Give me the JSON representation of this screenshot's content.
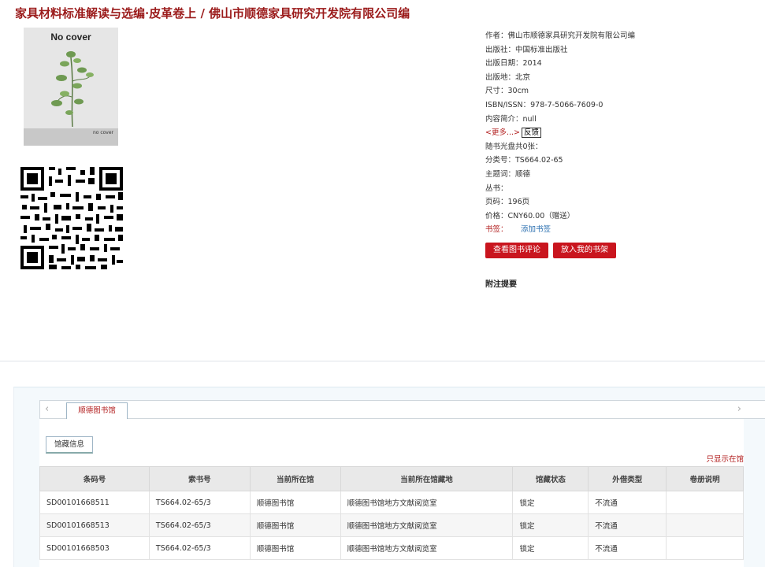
{
  "book": {
    "title": "家具材料标准解读与选编·皮革卷上 / 佛山市顺德家具研究开发院有限公司编",
    "cover_top_text": "No cover",
    "cover_bottom_text": "no cover"
  },
  "meta": {
    "author": "作者：佛山市顺德家具研究开发院有限公司编",
    "publisher": "出版社：中国标准出版社",
    "pub_date": "出版日期：2014",
    "pub_place": "出版地：北京",
    "size": "尺寸：30cm",
    "isbn": "ISBN/ISSN：978-7-5066-7609-0",
    "summary": "内容简介：null",
    "more_link": "<更多...>",
    "feedback_button": "反馈",
    "cd": "随书光盘共0张：",
    "class_no": "分类号：TS664.02-65",
    "subject": "主题词：顺德",
    "series": "丛书：",
    "pages": "页码：196页",
    "price": "价格：CNY60.00（赠送）",
    "bookmark_label": "书签：",
    "bookmark_link": "添加书签",
    "review_button": "查看图书评论",
    "shelf_button": "放入我的书架",
    "note_heading": "附注提要"
  },
  "holdings": {
    "library_tab": "顺德图书馆",
    "info_tab": "馆藏信息",
    "only_show": "只显示在馆",
    "columns": [
      "条码号",
      "索书号",
      "当前所在馆",
      "当前所在馆藏地",
      "馆藏状态",
      "外借类型",
      "卷册说明"
    ],
    "rows": [
      [
        "SD00101668511",
        "TS664.02-65/3",
        "顺德图书馆",
        "顺德图书馆地方文献阅览室",
        "锁定",
        "不流通",
        ""
      ],
      [
        "SD00101668513",
        "TS664.02-65/3",
        "顺德图书馆",
        "顺德图书馆地方文献阅览室",
        "锁定",
        "不流通",
        ""
      ],
      [
        "SD00101668503",
        "TS664.02-65/3",
        "顺德图书馆",
        "顺德图书馆地方文献阅览室",
        "锁定",
        "不流通",
        ""
      ]
    ]
  },
  "icons": {
    "tab_prev": "chevron-left-icon",
    "tab_next": "chevron-right-icon"
  },
  "colors": {
    "title": "#9b1b1b",
    "button": "#c9151e",
    "link": "#2a6fb0"
  }
}
